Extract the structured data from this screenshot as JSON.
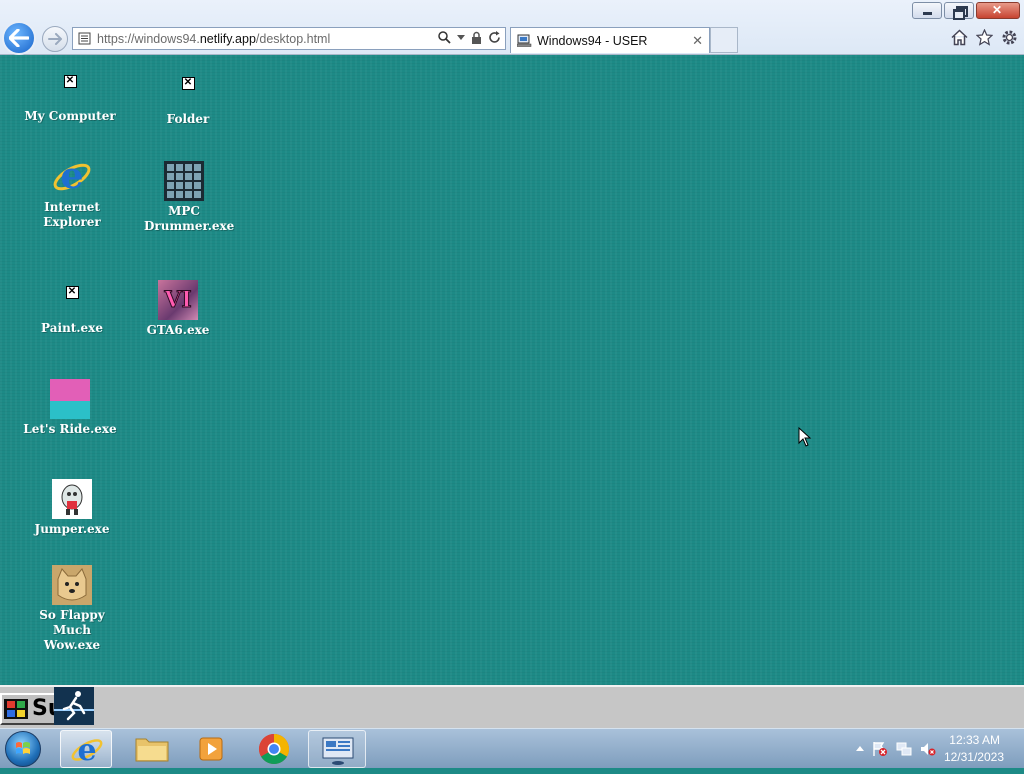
{
  "browser": {
    "url_prefix": "https://windows94.",
    "url_host": "netlify.app",
    "url_path": "/desktop.html",
    "tab_title": "Windows94 - USER",
    "tab_close": "✕"
  },
  "desktop": {
    "icons": [
      {
        "label": "My Computer"
      },
      {
        "label": "Folder"
      },
      {
        "label": "Internet Explorer"
      },
      {
        "label": "MPC Drummer.exe"
      },
      {
        "label": "Paint.exe"
      },
      {
        "label": "GTA6.exe",
        "badge": "VI"
      },
      {
        "label": "Let's Ride.exe"
      },
      {
        "label": "Jumper.exe"
      },
      {
        "label": "So Flappy Much Wow.exe"
      }
    ]
  },
  "w94_taskbar": {
    "start_text": "Su"
  },
  "w7_taskbar": {
    "time": "12:33 AM",
    "date": "12/31/2023"
  },
  "colors": {
    "desktop": "#1d8a86",
    "accent": "#1663c9"
  }
}
